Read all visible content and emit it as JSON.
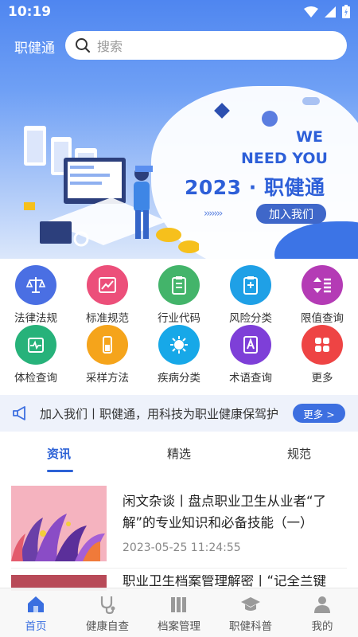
{
  "status_bar": {
    "time": "10:19"
  },
  "header": {
    "app_name": "职健通",
    "search_placeholder": "搜索"
  },
  "banner": {
    "line1": "WE",
    "line2": "NEED YOU",
    "title": "2023 · 职健通",
    "arrows": "›››››››",
    "button": "加入我们"
  },
  "categories": [
    {
      "label": "法律法规",
      "icon": "scale-icon",
      "color": "#4a6fe3"
    },
    {
      "label": "标准规范",
      "icon": "chart-icon",
      "color": "#ec4f7a"
    },
    {
      "label": "行业代码",
      "icon": "clipboard-icon",
      "color": "#43b46a"
    },
    {
      "label": "风险分类",
      "icon": "clipboard-plus-icon",
      "color": "#1fa0e6"
    },
    {
      "label": "限值查询",
      "icon": "sort-icon",
      "color": "#b43bb5"
    },
    {
      "label": "体检查询",
      "icon": "heartbeat-icon",
      "color": "#27b27a"
    },
    {
      "label": "采样方法",
      "icon": "sample-tube-icon",
      "color": "#f5a41b"
    },
    {
      "label": "疾病分类",
      "icon": "virus-icon",
      "color": "#17a8e8"
    },
    {
      "label": "术语查询",
      "icon": "dictionary-icon",
      "color": "#7e3fd8"
    },
    {
      "label": "更多",
      "icon": "grid-icon",
      "color": "#ee4444"
    }
  ],
  "notice": {
    "text": "加入我们丨职健通，用科技为职业健康保驾护航",
    "more": "更多 >"
  },
  "tabs": [
    {
      "label": "资讯",
      "active": true
    },
    {
      "label": "精选",
      "active": false
    },
    {
      "label": "规范",
      "active": false
    }
  ],
  "articles": [
    {
      "title": "闲文杂谈丨盘点职业卫生从业者“了解”的专业知识和必备技能（一）",
      "time": "2023-05-25 11:24:55"
    },
    {
      "title": "职业卫生档案管理解密丨“记全兰键步",
      "time": ""
    }
  ],
  "bottom_nav": [
    {
      "label": "首页",
      "icon": "home-icon",
      "active": true
    },
    {
      "label": "健康自查",
      "icon": "stethoscope-icon",
      "active": false
    },
    {
      "label": "档案管理",
      "icon": "books-icon",
      "active": false
    },
    {
      "label": "职健科普",
      "icon": "graduation-cap-icon",
      "active": false
    },
    {
      "label": "我的",
      "icon": "person-icon",
      "active": false
    }
  ]
}
